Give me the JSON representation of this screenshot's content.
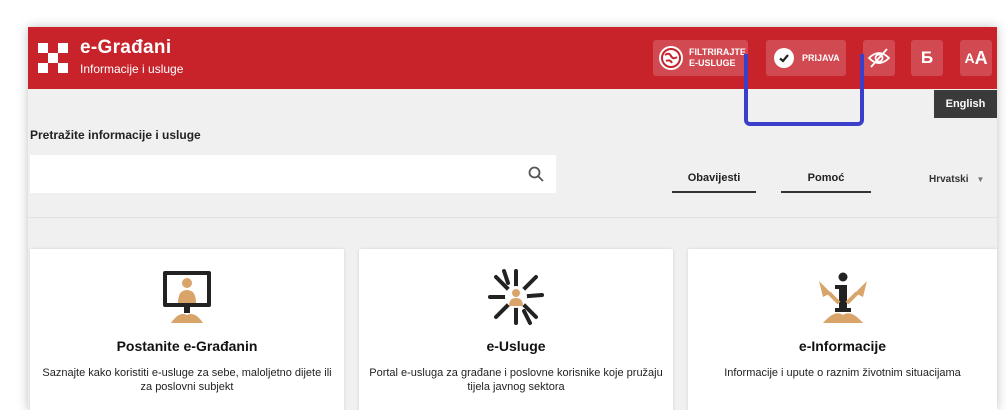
{
  "header": {
    "title": "e-Građani",
    "subtitle": "Informacije i usluge",
    "filter_button": {
      "line1": "FILTRIRAJTE",
      "line2": "E-USLUGE"
    },
    "login_button": "PRIJAVA",
    "hide_icon": "eye-slash-icon",
    "b_button": "Б",
    "font_button_small": "A",
    "font_button_big": "A",
    "brand_color": "#c8232b"
  },
  "language_link": "English",
  "search": {
    "label": "Pretražite informacije i usluge",
    "value": "",
    "placeholder": ""
  },
  "tabs": [
    "Obavijesti",
    "Pomoć"
  ],
  "language_select": "Hrvatski",
  "cards": [
    {
      "title": "Postanite e-Građanin",
      "description": "Saznajte kako koristiti e-usluge za sebe, maloljetno dijete ili za poslovni subjekt",
      "icon": "person-at-computer-icon"
    },
    {
      "title": "e-Usluge",
      "description": "Portal e-usluga za građane i poslovne korisnike koje pružaju tijela javnog sektora",
      "icon": "network-person-icon"
    },
    {
      "title": "e-Informacije",
      "description": "Informacije i upute o raznim životnim situacijama",
      "icon": "info-person-icon"
    }
  ]
}
